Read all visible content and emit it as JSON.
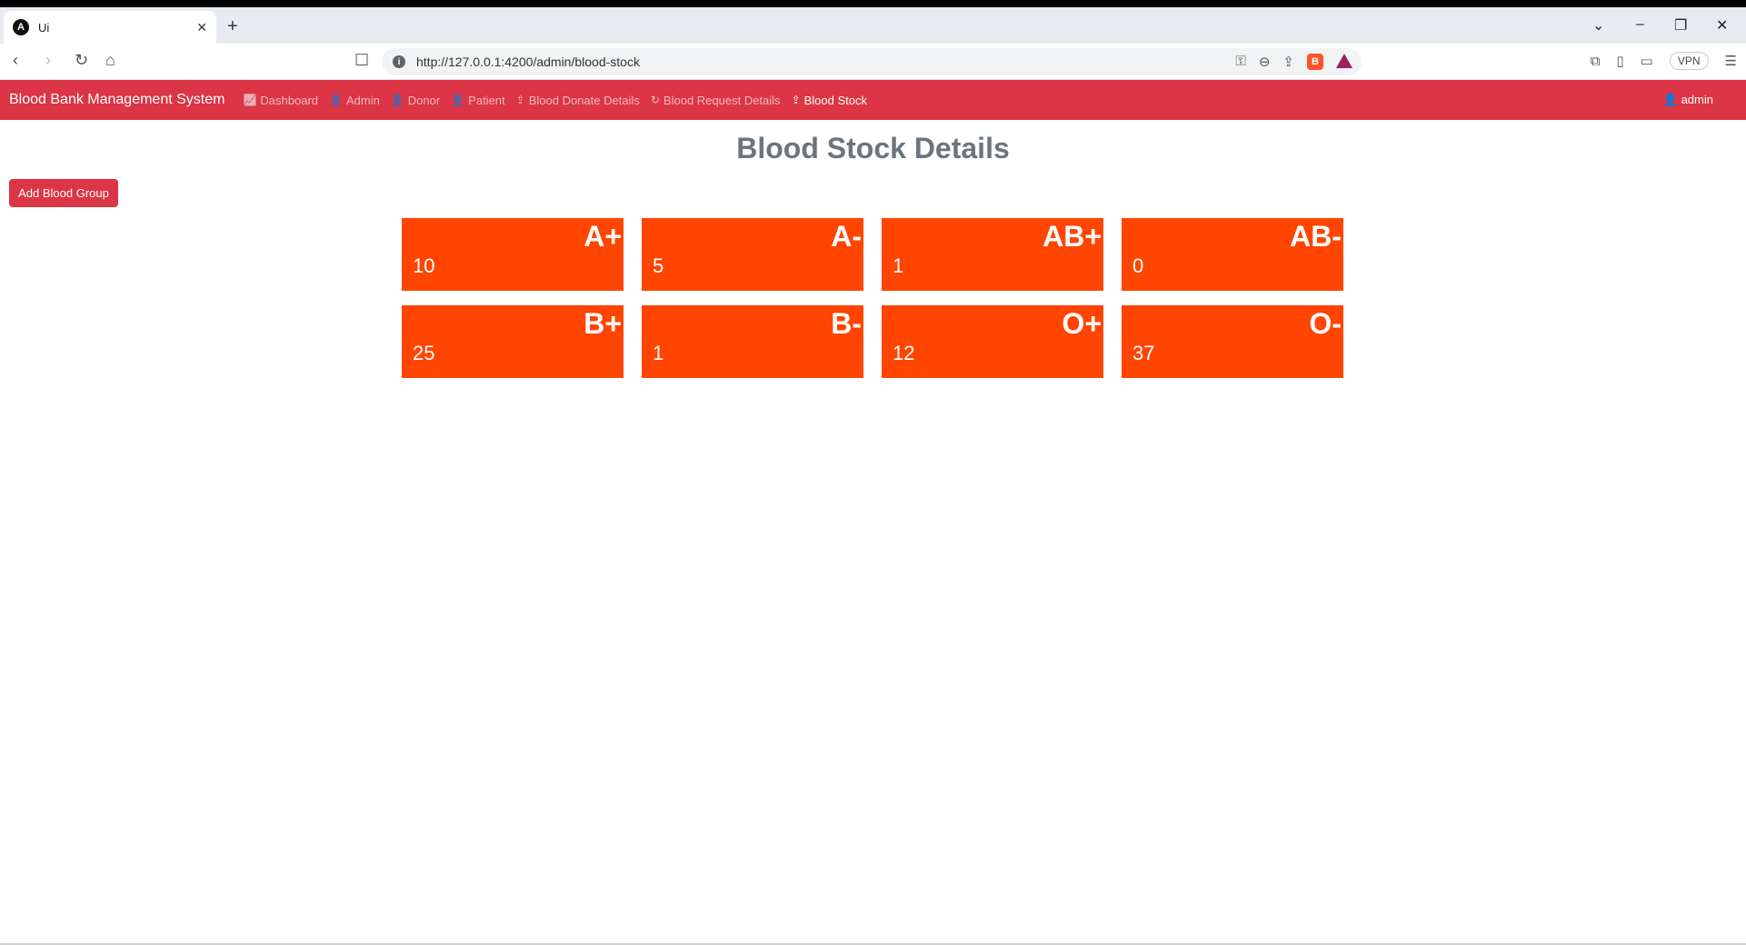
{
  "browser": {
    "tab_title": "Ui",
    "tab_favicon": "A",
    "url": "http://127.0.0.1:4200/admin/blood-stock",
    "vpn_label": "VPN"
  },
  "navbar": {
    "brand": "Blood Bank Management System",
    "items": [
      {
        "label": "Dashboard",
        "icon": "chart-icon"
      },
      {
        "label": "Admin",
        "icon": "user-icon"
      },
      {
        "label": "Donor",
        "icon": "user-icon"
      },
      {
        "label": "Patient",
        "icon": "user-icon"
      },
      {
        "label": "Blood Donate Details",
        "icon": "donate-icon"
      },
      {
        "label": "Blood Request Details",
        "icon": "refresh-icon"
      },
      {
        "label": "Blood Stock",
        "icon": "donate-icon"
      }
    ],
    "user": "admin",
    "bg_color": "#dc3545"
  },
  "main": {
    "title": "Blood Stock Details",
    "add_button": "Add Blood Group",
    "card_color": "#ff4500",
    "stock": [
      {
        "group": "A+",
        "units": "10"
      },
      {
        "group": "A-",
        "units": "5"
      },
      {
        "group": "AB+",
        "units": "1"
      },
      {
        "group": "AB-",
        "units": "0"
      },
      {
        "group": "B+",
        "units": "25"
      },
      {
        "group": "B-",
        "units": "1"
      },
      {
        "group": "O+",
        "units": "12"
      },
      {
        "group": "O-",
        "units": "37"
      }
    ]
  }
}
